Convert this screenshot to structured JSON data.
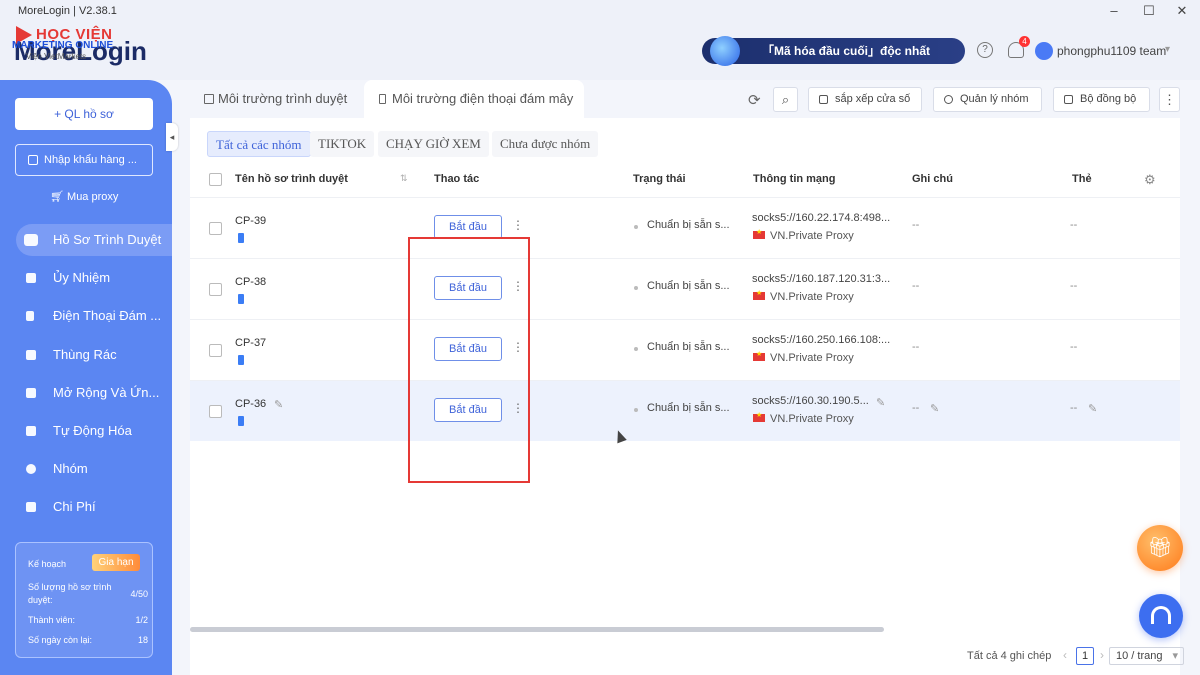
{
  "window": {
    "title": "MoreLogin | V2.38.1",
    "controls": [
      "–",
      "☐",
      "✕"
    ]
  },
  "watermark": {
    "line1": "HỌC VIỆN",
    "line2": "MARKETING ONLINE",
    "line3": "Viện VietMarkets"
  },
  "brand": {
    "name": "MoreLogin"
  },
  "header": {
    "promo": "「Mã hóa đầu cuối」độc nhất",
    "help_icon": "?",
    "notification_count": "4",
    "user": "phongphu1109 team"
  },
  "sidebar": {
    "new_profile": "+ QL hồ sơ",
    "import": "Nhập khẩu hàng ...",
    "buy_proxy": "Mua proxy",
    "items": [
      {
        "label": "Hồ Sơ Trình Duyệt",
        "icon": "browser-icon",
        "active": true
      },
      {
        "label": "Ủy Nhiệm",
        "icon": "proxy-icon"
      },
      {
        "label": "Điện Thoại Đám ...",
        "icon": "phone-icon"
      },
      {
        "label": "Thùng Rác",
        "icon": "trash-icon"
      },
      {
        "label": "Mở Rộng Và Ứn...",
        "icon": "puzzle-icon"
      },
      {
        "label": "Tự Động Hóa",
        "icon": "automation-icon"
      },
      {
        "label": "Nhóm",
        "icon": "group-icon"
      },
      {
        "label": "Chi Phí",
        "icon": "billing-icon"
      }
    ],
    "plan": {
      "title": "Kế hoạch",
      "renew": "Gia hạn",
      "profiles_label": "Số lượng hồ sơ trình duyệt:",
      "profiles_value": "4/50",
      "members_label": "Thành viên:",
      "members_value": "1/2",
      "days_label": "Số ngày còn lại:",
      "days_value": "18"
    }
  },
  "tabs": [
    {
      "label": "Môi trường trình duyệt",
      "active": false
    },
    {
      "label": "Môi trường điện thoại đám mây",
      "active": true
    }
  ],
  "toolbar": {
    "arrange": "sắp xếp cửa số",
    "groups": "Quản lý nhóm",
    "sync": "Bộ đồng bộ"
  },
  "filters": [
    "Tất cả các nhóm",
    "TIKTOK",
    "CHẠY GIỜ XEM",
    "Chưa được nhóm"
  ],
  "columns": {
    "name": "Tên hồ sơ trình duyệt",
    "action": "Thao tác",
    "status": "Trạng thái",
    "network": "Thông tin mạng",
    "note": "Ghi chú",
    "tag": "Thẻ"
  },
  "rows": [
    {
      "name": "CP-39",
      "action": "Bắt đầu",
      "status": "Chuẩn bị sẵn s...",
      "network": "socks5://160.22.174.8:498...",
      "proxy": "VN.Private Proxy",
      "note": "--",
      "tag": "--"
    },
    {
      "name": "CP-38",
      "action": "Bắt đầu",
      "status": "Chuẩn bị sẵn s...",
      "network": "socks5://160.187.120.31:3...",
      "proxy": "VN.Private Proxy",
      "note": "--",
      "tag": "--"
    },
    {
      "name": "CP-37",
      "action": "Bắt đầu",
      "status": "Chuẩn bị sẵn s...",
      "network": "socks5://160.250.166.108:...",
      "proxy": "VN.Private Proxy",
      "note": "--",
      "tag": "--"
    },
    {
      "name": "CP-36",
      "action": "Bắt đầu",
      "status": "Chuẩn bị sẵn s...",
      "network": "socks5://160.30.190.5...",
      "proxy": "VN.Private Proxy",
      "note": "--",
      "tag": "--"
    }
  ],
  "footer": {
    "total": "Tất cả 4 ghi chép",
    "page": "1",
    "page_size": "10 / trang"
  },
  "colors": {
    "sidebar": "#5b86f2",
    "accent": "#3f63d9",
    "highlight_box": "#e53935"
  }
}
